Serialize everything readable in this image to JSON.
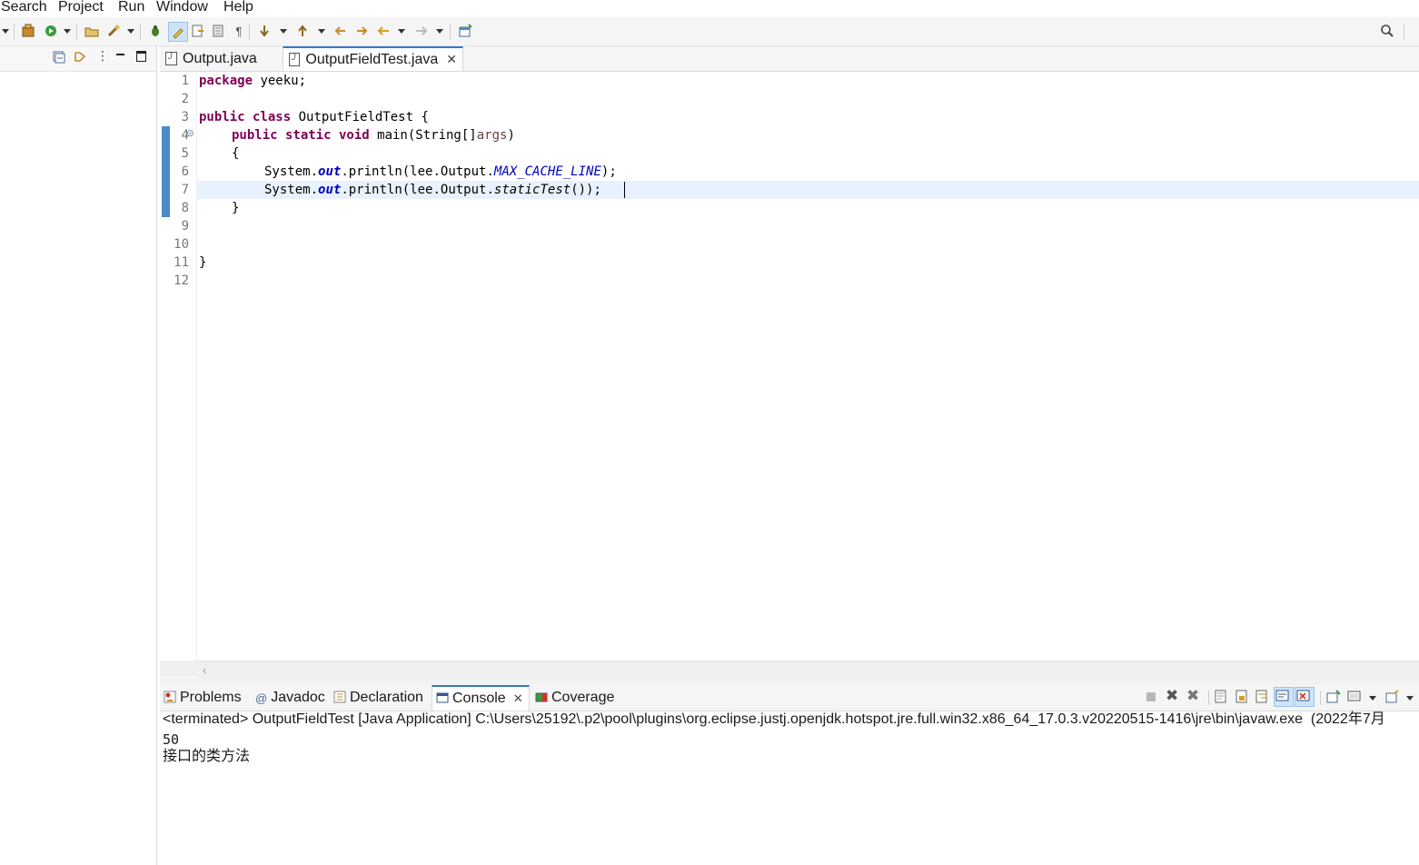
{
  "menu": [
    "Search",
    "Project",
    "Run",
    "Window",
    "Help"
  ],
  "toolbar_icons": [
    "new-icon",
    "run-icon",
    "open-icon",
    "tools-icon",
    "debug-icon",
    "highlight-icon",
    "format-icon",
    "doc-icon",
    "pilcrow-icon",
    "next-annotation-icon",
    "prev-annotation-icon",
    "last-edit-icon",
    "forward-edit-icon",
    "back-icon",
    "forward-icon",
    "open-perspective-icon",
    "search-icon"
  ],
  "editor": {
    "tabs": [
      {
        "label": "Output.java",
        "active": false
      },
      {
        "label": "OutputFieldTest.java",
        "active": true
      }
    ],
    "lines": [
      "1",
      "2",
      "3",
      "4",
      "5",
      "6",
      "7",
      "8",
      "9",
      "10",
      "11",
      "12"
    ],
    "code": {
      "pkg_kw": "package",
      "pkg_name": " yeeku;",
      "l3_kw": "public class",
      "l3_rest": " OutputFieldTest {",
      "l4_kw": "public static void",
      "l4_mid": " main(String[]",
      "l4_arg": "args",
      "l4_end": ")",
      "l5": "{",
      "l6_a": "System.",
      "l6_b": "out",
      "l6_c": ".println(lee.Output.",
      "l6_d": "MAX_CACHE_LINE",
      "l6_e": ");",
      "l7_a": "System.",
      "l7_b": "out",
      "l7_c": ".println(lee.Output.",
      "l7_d": "staticTest",
      "l7_e": "());",
      "l8": "}",
      "l11": "}"
    }
  },
  "bottom_tabs": [
    {
      "label": "Problems",
      "icon": "problems-icon"
    },
    {
      "label": "Javadoc",
      "icon": "at-icon"
    },
    {
      "label": "Declaration",
      "icon": "declaration-icon"
    },
    {
      "label": "Console",
      "icon": "console-icon",
      "active": true
    },
    {
      "label": "Coverage",
      "icon": "coverage-icon"
    }
  ],
  "console": {
    "header": "<terminated> OutputFieldTest [Java Application] C:\\Users\\25192\\.p2\\pool\\plugins\\org.eclipse.justj.openjdk.hotspot.jre.full.win32.x86_64_17.0.3.v20220515-1416\\jre\\bin\\javaw.exe  (2022年7月",
    "lines": [
      "50",
      "接口的类方法"
    ]
  }
}
